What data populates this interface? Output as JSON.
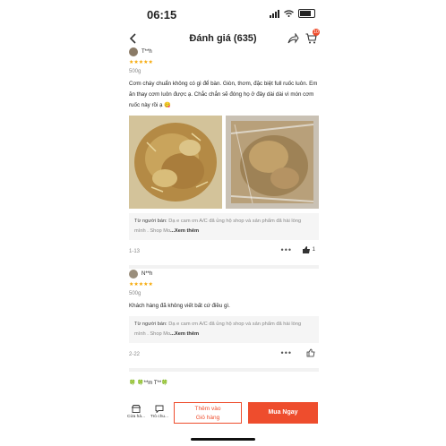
{
  "status": {
    "time": "06:15"
  },
  "header": {
    "title": "Đánh giá (635)",
    "cart_badge": "10"
  },
  "reviews": [
    {
      "user": "T**h",
      "variant": "500g",
      "text": "Cơm cháy chuẩn không có gì để bàn. Giòn, thơm, đặc biệt full ruốc luôn. Em ăn thay cơm luôn được ạ. Chắc chắn sẽ đóng họ ở đây dài dài vì món cơm ruốc này rồi ạ 😋",
      "seller_prefix": "Từ người bán:",
      "seller_reply": "Dạ e cam ơn A/C đã ủng hộ shop và sản phẩm đã hài lòng mình . Shop Mo",
      "more": "...Xem thêm",
      "date": "1-13",
      "likes": "1"
    },
    {
      "user": "N**h",
      "variant": "500g",
      "text": "Khách hàng đã không viết bất cứ điều gì.",
      "seller_prefix": "Từ người bán:",
      "seller_reply": "Dạ e cam ơn A/C đã ủng hộ shop và sản phẩm đã hài lòng mình . Shop Mo",
      "more": "...Xem thêm",
      "date": "2-22",
      "likes": ""
    }
  ],
  "partial_review": {
    "user": "🍀 🍀**m T**🍀"
  },
  "bottom": {
    "shop_label": "Cửa hà...",
    "chat_label": "Trò chu...",
    "add_cart_line1": "Thêm vào",
    "add_cart_line2": "Giỏ hàng",
    "buy_now": "Mua Ngay"
  },
  "colors": {
    "accent": "#ee4d2d",
    "star": "#f6a700"
  },
  "icons": [
    "back-arrow-icon",
    "share-icon",
    "cart-icon",
    "more-dots-icon",
    "thumbs-up-icon",
    "shop-icon",
    "chat-icon"
  ]
}
